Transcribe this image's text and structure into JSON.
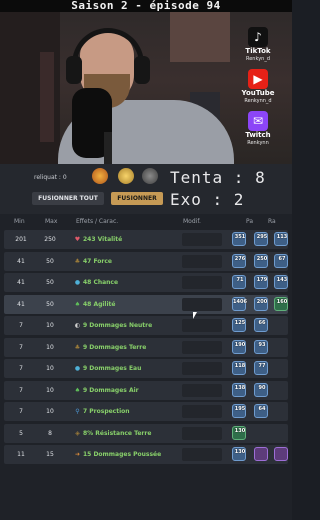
{
  "title": "Saison 2 - épisode 94",
  "socials": [
    {
      "icon": "tiktok-icon",
      "name": "TikTok",
      "handle": "Renkyn_d",
      "color": "#111111",
      "glyph": "♪"
    },
    {
      "icon": "youtube-icon",
      "name": "YouTube",
      "handle": "Renkynn_d",
      "color": "#e62117",
      "glyph": "▶"
    },
    {
      "icon": "twitch-icon",
      "name": "Twitch",
      "handle": "Renkynn",
      "color": "#8c45f7",
      "glyph": "✉"
    }
  ],
  "topbar": {
    "reliquat": "reliquat : 0",
    "btn_fusionner_tout": "FUSIONNER TOUT",
    "btn_fusionner": "FUSIONNER",
    "tenta": "Tenta : 8",
    "exo": "Exo : 2"
  },
  "table": {
    "headers": {
      "min": "Min",
      "max": "Max",
      "effets": "Effets / Carac.",
      "modif": "Modif.",
      "pa": "Pa",
      "ra": "Ra"
    },
    "rows": [
      {
        "min": "201",
        "max": "250",
        "effect": "243 Vitalité",
        "icon_color": "#e05a6a",
        "glyph": "♥",
        "runes": [
          {
            "count": "351",
            "type": "r-blue"
          },
          {
            "count": "295",
            "type": "r-blue"
          },
          {
            "count": "113",
            "type": "r-blue"
          }
        ],
        "highlight": false
      },
      {
        "min": "41",
        "max": "50",
        "effect": "47 Force",
        "icon_color": "#9b7b3a",
        "glyph": "♣",
        "runes": [
          {
            "count": "276",
            "type": "r-blue"
          },
          {
            "count": "250",
            "type": "r-blue"
          },
          {
            "count": "67",
            "type": "r-blue"
          }
        ],
        "highlight": false
      },
      {
        "min": "41",
        "max": "50",
        "effect": "48 Chance",
        "icon_color": "#4fb1d8",
        "glyph": "●",
        "runes": [
          {
            "count": "71",
            "type": "r-blue"
          },
          {
            "count": "179",
            "type": "r-blue"
          },
          {
            "count": "143",
            "type": "r-blue"
          }
        ],
        "highlight": false
      },
      {
        "min": "41",
        "max": "50",
        "effect": "48 Agilité",
        "icon_color": "#5fbf5a",
        "glyph": "♠",
        "runes": [
          {
            "count": "1406",
            "type": "r-blue"
          },
          {
            "count": "200",
            "type": "r-blue"
          },
          {
            "count": "160",
            "type": "r-green"
          }
        ],
        "highlight": true
      },
      {
        "min": "7",
        "max": "10",
        "effect": "9 Dommages Neutre",
        "icon_color": "#d0d0d0",
        "glyph": "◐",
        "runes": [
          {
            "count": "125",
            "type": "r-blue"
          },
          {
            "count": "66",
            "type": "r-blue"
          }
        ],
        "highlight": false
      },
      {
        "min": "7",
        "max": "10",
        "effect": "9 Dommages Terre",
        "icon_color": "#9b7b3a",
        "glyph": "♣",
        "runes": [
          {
            "count": "190",
            "type": "r-blue"
          },
          {
            "count": "93",
            "type": "r-blue"
          }
        ],
        "highlight": false
      },
      {
        "min": "7",
        "max": "10",
        "effect": "9 Dommages Eau",
        "icon_color": "#4fb1d8",
        "glyph": "●",
        "runes": [
          {
            "count": "118",
            "type": "r-blue"
          },
          {
            "count": "77",
            "type": "r-blue"
          }
        ],
        "highlight": false
      },
      {
        "min": "7",
        "max": "10",
        "effect": "9 Dommages Air",
        "icon_color": "#5fbf5a",
        "glyph": "♠",
        "runes": [
          {
            "count": "138",
            "type": "r-blue"
          },
          {
            "count": "90",
            "type": "r-blue"
          }
        ],
        "highlight": false
      },
      {
        "min": "7",
        "max": "10",
        "effect": "7 Prospection",
        "icon_color": "#4f9ad8",
        "glyph": "⚲",
        "runes": [
          {
            "count": "195",
            "type": "r-blue"
          },
          {
            "count": "64",
            "type": "r-blue"
          }
        ],
        "highlight": false
      },
      {
        "min": "5",
        "max": "8",
        "effect": "8% Résistance Terre",
        "icon_color": "#9b7b3a",
        "glyph": "◈",
        "runes": [
          {
            "count": "130",
            "type": "r-green"
          }
        ],
        "highlight": false
      },
      {
        "min": "11",
        "max": "15",
        "effect": "15 Dommages Poussée",
        "icon_color": "#d98a3a",
        "glyph": "➜",
        "runes": [
          {
            "count": "130",
            "type": "r-blue"
          },
          {
            "count": "",
            "type": "r-pink"
          },
          {
            "count": "",
            "type": "r-pink"
          }
        ],
        "highlight": false
      }
    ]
  }
}
